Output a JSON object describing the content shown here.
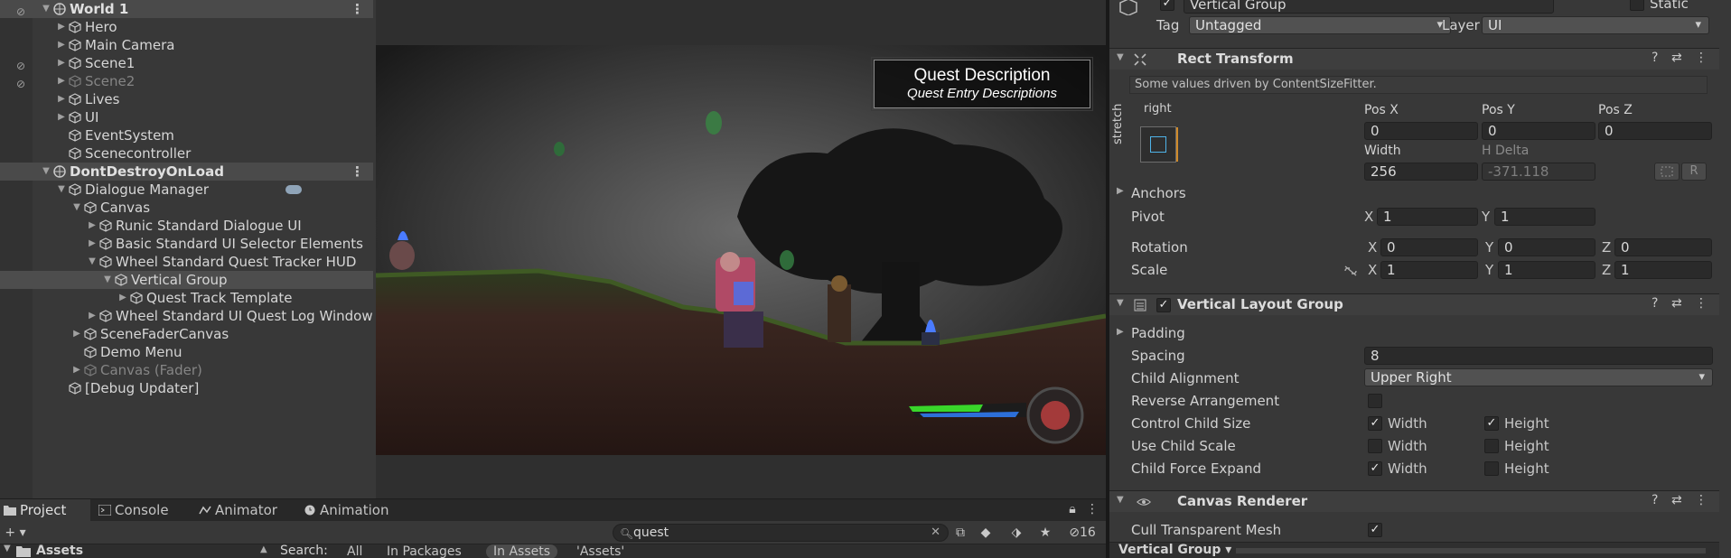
{
  "hierarchy": {
    "rows": [
      {
        "label": "World 1",
        "depth": 0,
        "scene": true,
        "fold": "▼",
        "kebab": "⋮",
        "vis": true
      },
      {
        "label": "Hero",
        "depth": 1,
        "fold": "▶"
      },
      {
        "label": "Main Camera",
        "depth": 1,
        "fold": "▶"
      },
      {
        "label": "Scene1",
        "depth": 1,
        "fold": "▶",
        "vis": true
      },
      {
        "label": "Scene2",
        "depth": 1,
        "fold": "▶",
        "dim": true,
        "vis": true
      },
      {
        "label": "Lives",
        "depth": 1,
        "fold": "▶"
      },
      {
        "label": "UI",
        "depth": 1,
        "fold": "▶"
      },
      {
        "label": "EventSystem",
        "depth": 1,
        "fold": ""
      },
      {
        "label": "Scenecontroller",
        "depth": 1,
        "fold": ""
      },
      {
        "label": "DontDestroyOnLoad",
        "depth": 0,
        "scene": true,
        "fold": "▼",
        "kebab": "⋮"
      },
      {
        "label": "Dialogue Manager",
        "depth": 1,
        "fold": "▼",
        "badge": true
      },
      {
        "label": "Canvas",
        "depth": 2,
        "fold": "▼"
      },
      {
        "label": "Runic Standard Dialogue UI",
        "depth": 3,
        "fold": "▶"
      },
      {
        "label": "Basic Standard UI Selector Elements",
        "depth": 3,
        "fold": "▶"
      },
      {
        "label": "Wheel Standard Quest Tracker HUD",
        "depth": 3,
        "fold": "▼"
      },
      {
        "label": "Vertical Group",
        "depth": 4,
        "fold": "▼",
        "selected": true
      },
      {
        "label": "Quest Track Template",
        "depth": 5,
        "fold": "▶"
      },
      {
        "label": "Wheel Standard UI Quest Log Window",
        "depth": 3,
        "fold": "▶"
      },
      {
        "label": "SceneFaderCanvas",
        "depth": 2,
        "fold": "▶"
      },
      {
        "label": "Demo Menu",
        "depth": 2,
        "fold": ""
      },
      {
        "label": "Canvas (Fader)",
        "depth": 2,
        "fold": "▶",
        "dim": true
      },
      {
        "label": "[Debug Updater]",
        "depth": 1,
        "fold": ""
      }
    ]
  },
  "game": {
    "quest_title": "Quest Description",
    "quest_subtitle": "Quest Entry Descriptions",
    "health_fill": 0.62
  },
  "inspector": {
    "object_name": "Vertical Group",
    "static_label": "Static",
    "tag_label": "Tag",
    "tag_value": "Untagged",
    "layer_label": "Layer",
    "layer_value": "UI",
    "rect": {
      "title": "Rect Transform",
      "note": "Some values driven by ContentSizeFitter.",
      "anchor_h": "right",
      "anchor_v": "stretch",
      "posx_label": "Pos X",
      "posx": "0",
      "posy_label": "Pos Y",
      "posy": "0",
      "posz_label": "Pos Z",
      "posz": "0",
      "width_label": "Width",
      "width": "256",
      "hdelta_label": "H Delta",
      "hdelta": "-371.118",
      "r_button": "R",
      "anchors_label": "Anchors",
      "pivot_label": "Pivot",
      "pivot_x": "1",
      "pivot_y": "1",
      "rotation_label": "Rotation",
      "rot_x": "0",
      "rot_y": "0",
      "rot_z": "0",
      "scale_label": "Scale",
      "scale_x": "1",
      "scale_y": "1",
      "scale_z": "1",
      "x": "X",
      "y": "Y",
      "z": "Z"
    },
    "vlg": {
      "title": "Vertical Layout Group",
      "padding_label": "Padding",
      "spacing_label": "Spacing",
      "spacing": "8",
      "child_alignment_label": "Child Alignment",
      "child_alignment": "Upper Right",
      "reverse_label": "Reverse Arrangement",
      "control_label": "Control Child Size",
      "scale_label": "Use Child Scale",
      "expand_label": "Child Force Expand",
      "width": "Width",
      "height": "Height",
      "control_width": true,
      "control_height": true,
      "scale_width": false,
      "scale_height": false,
      "expand_width": true,
      "expand_height": false,
      "reverse": false
    },
    "canvas_renderer": {
      "title": "Canvas Renderer",
      "cull_label": "Cull Transparent Mesh",
      "cull": true
    },
    "footer_label": "Vertical Group ▾",
    "help": "?",
    "preset": "⇄",
    "menu": "⋮"
  },
  "project": {
    "tabs": [
      "Project",
      "Console",
      "Animator",
      "Animation"
    ],
    "search_value": "quest",
    "hidden_count": "16",
    "assets_label": "Assets",
    "search_label": "Search:",
    "scope_all": "All",
    "scope_packages": "In Packages",
    "scope_assets": "In Assets",
    "scope_folder": "'Assets'",
    "add": "+ ▾"
  },
  "colors": {
    "selection": "#4d4d4d",
    "accent_check": "#e8e8e8",
    "health_green": "#39d62a",
    "health_blue": "#2d6fd8"
  }
}
